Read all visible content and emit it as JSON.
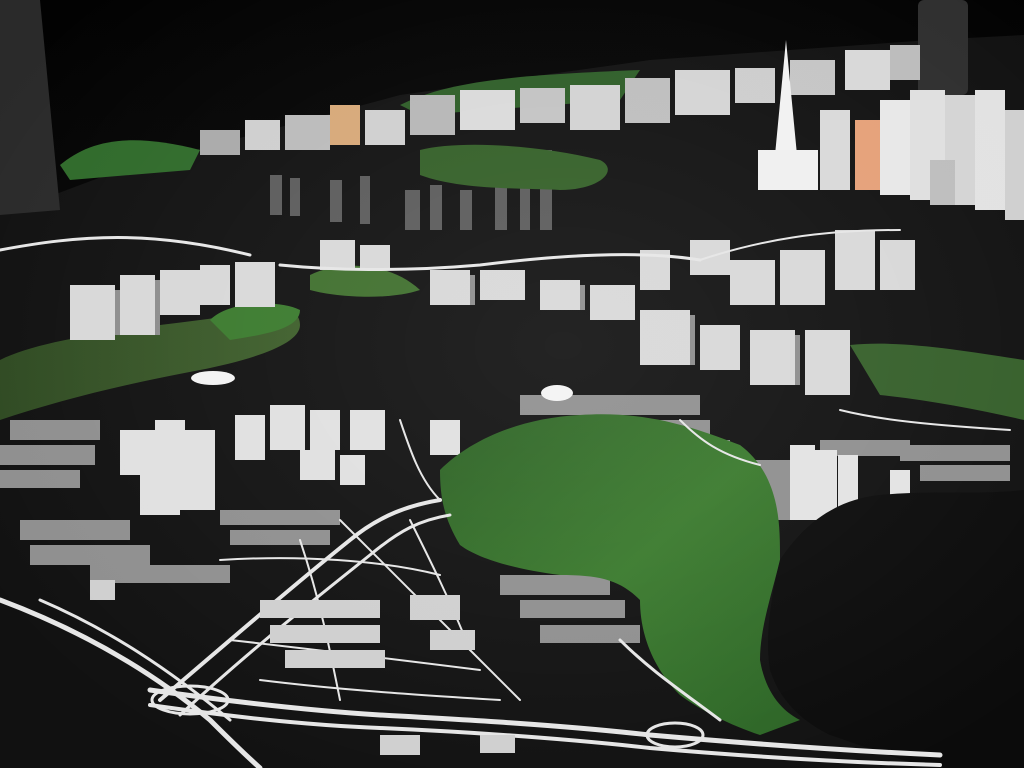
{
  "image": {
    "scene": "city-scale-model-photo",
    "colors": {
      "background": "#060606",
      "ground": "#111111",
      "roads": "#e6e6e6",
      "buildings": "#d9d9d9",
      "building_shadow": "#8c8c8c",
      "green_areas": "#2f6d2a",
      "water": "#0c0c0c",
      "accent_buildings": "#d88f5a"
    }
  }
}
